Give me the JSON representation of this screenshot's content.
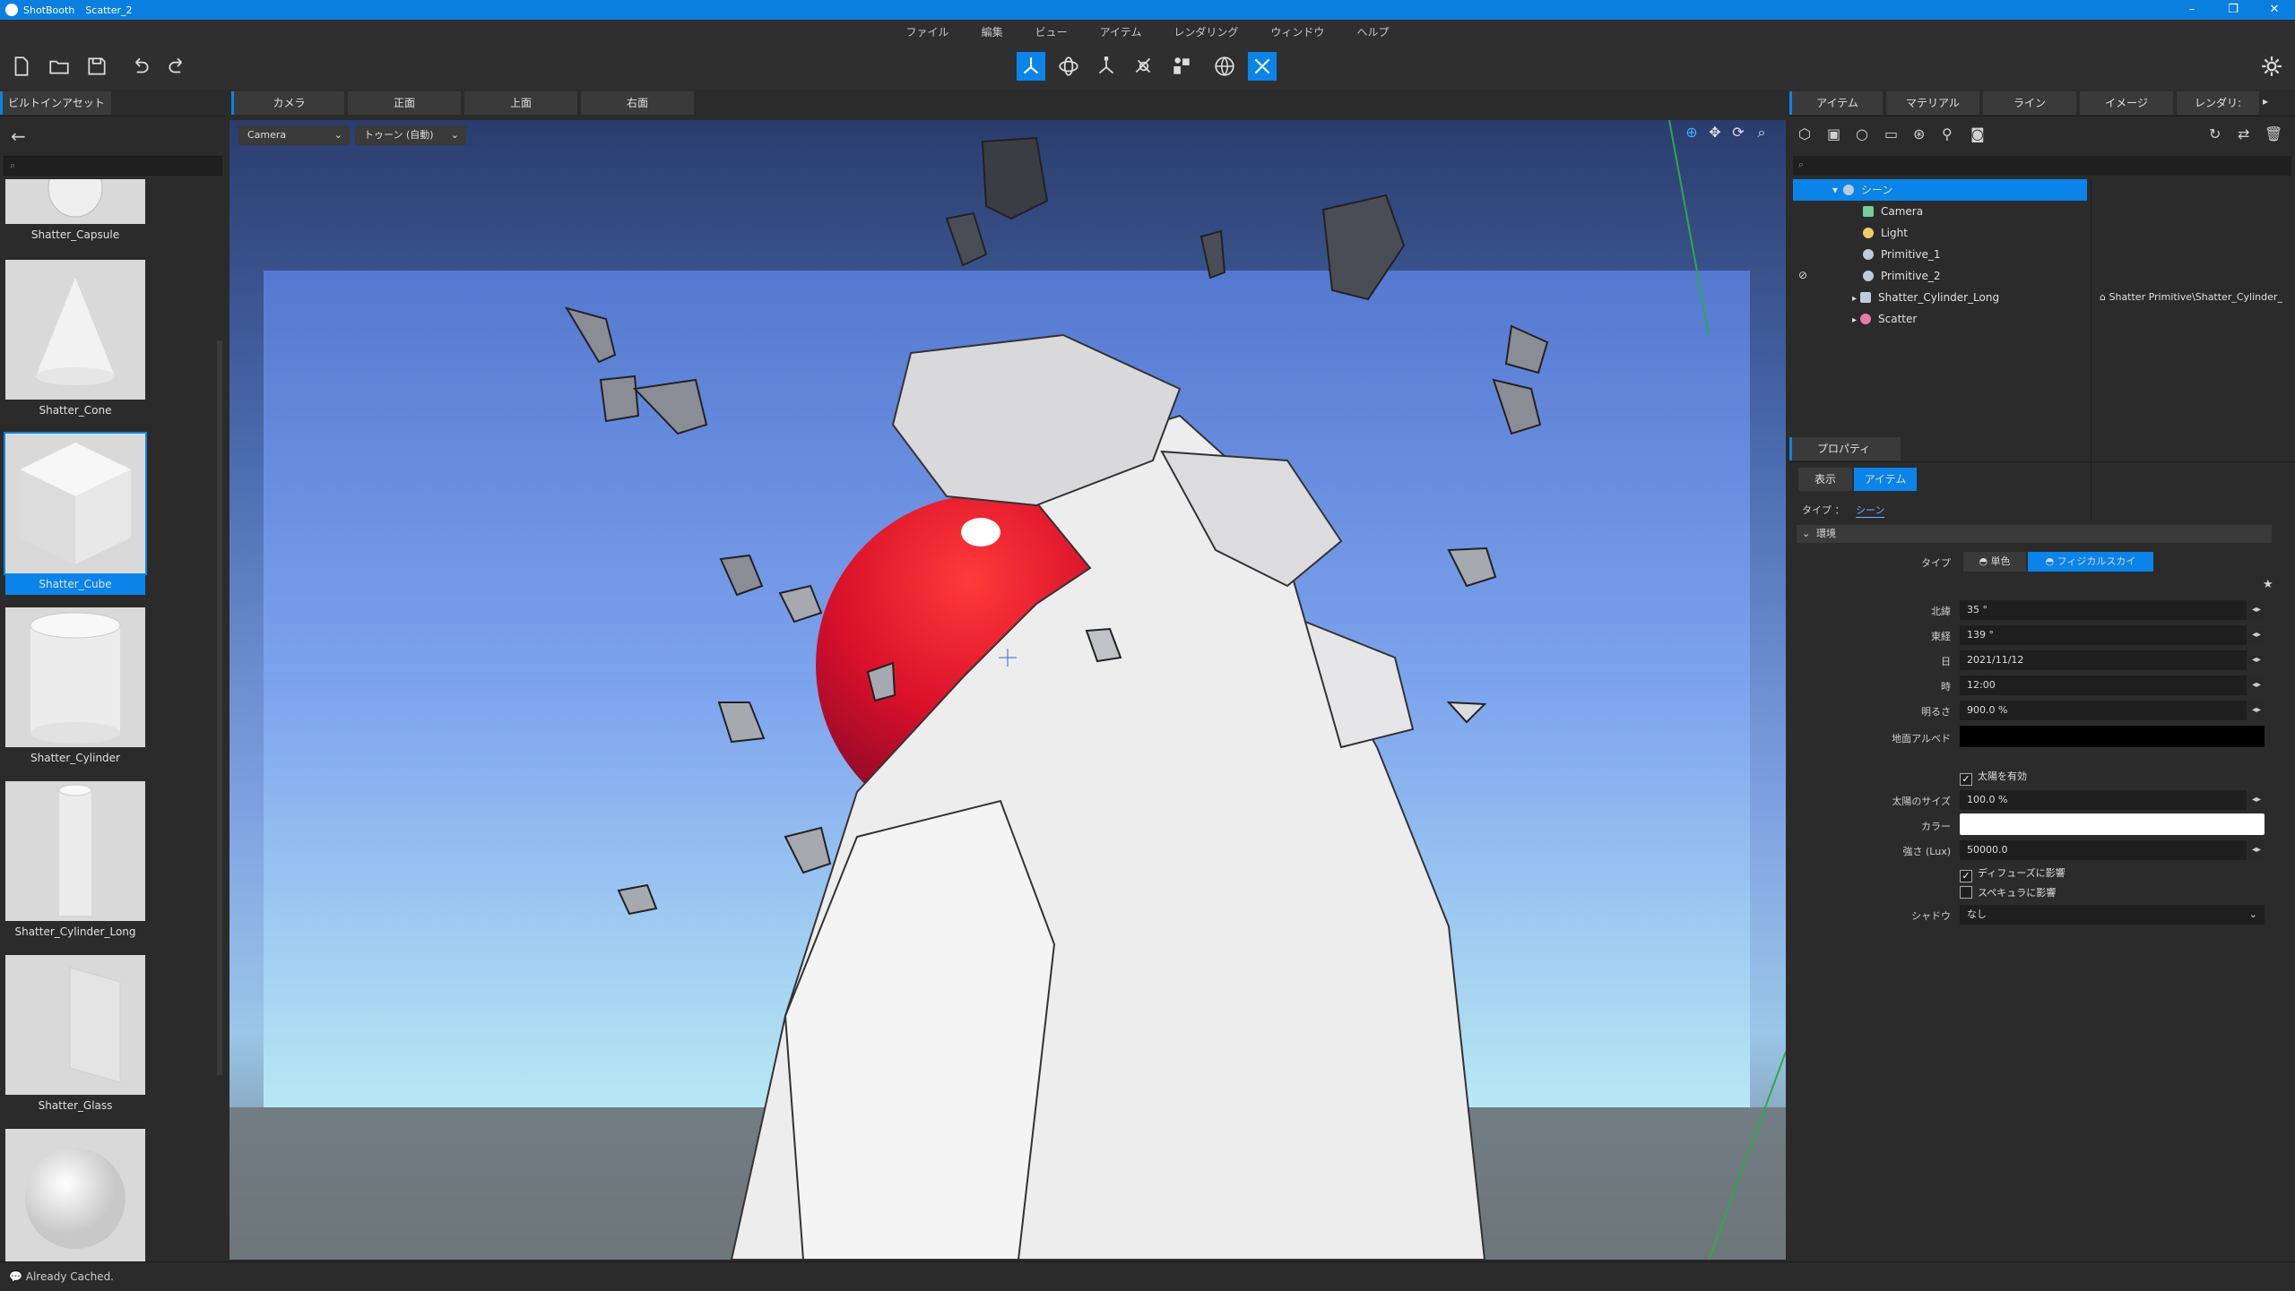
{
  "titlebar": {
    "app": "ShotBooth",
    "doc": "Scatter_2"
  },
  "menu": [
    "ファイル",
    "編集",
    "ビュー",
    "アイテム",
    "レンダリング",
    "ウィンドウ",
    "ヘルプ"
  ],
  "left_panel": {
    "tab": "ビルトインアセット",
    "assets": [
      "Shatter_Capsule",
      "Shatter_Cone",
      "Shatter_Cube",
      "Shatter_Cylinder",
      "Shatter_Cylinder_Long",
      "Shatter_Glass",
      ""
    ]
  },
  "viewport": {
    "tabs": [
      "カメラ",
      "正面",
      "上面",
      "右面"
    ],
    "camera_dropdown": "Camera",
    "shading_dropdown": "トゥーン (自動)"
  },
  "right_panel": {
    "tabs": [
      "アイテム",
      "マテリアル",
      "ライン",
      "イメージ",
      "レンダリ:"
    ],
    "tree": {
      "root": "シーン",
      "items": [
        "Camera",
        "Light",
        "Primitive_1",
        "Primitive_2",
        "Shatter_Cylinder_Long",
        "Scatter"
      ],
      "asset_path": "Shatter Primitive\\Shatter_Cylinder_"
    },
    "properties_tab": "プロパティ",
    "mode_tabs": [
      "表示",
      "アイテム"
    ],
    "type_label": "タイプ ：",
    "type_value": "シーン",
    "section": "環境",
    "env_type_label": "タイプ",
    "env_type_options": [
      "単色",
      "フィジカルスカイ"
    ],
    "fields": [
      {
        "label": "北緯",
        "value": "35 °"
      },
      {
        "label": "東経",
        "value": "139 °"
      },
      {
        "label": "日",
        "value": "2021/11/12"
      },
      {
        "label": "時",
        "value": "12:00"
      },
      {
        "label": "明るさ",
        "value": "900.0 %"
      }
    ],
    "ground_albedo_label": "地面アルベド",
    "sun_enable": "太陽を有効",
    "sun_size_label": "太陽のサイズ",
    "sun_size_value": "100.0 %",
    "color_label": "カラー",
    "intensity_label": "強さ (Lux)",
    "intensity_value": "50000.0",
    "affect_diffuse": "ディフューズに影響",
    "affect_specular": "スペキュラに影響",
    "shadow_label": "シャドウ",
    "shadow_value": "なし"
  },
  "status": "Already Cached.",
  "colors": {
    "accent": "#0a84e8",
    "titlebar": "#0a7fe0",
    "panel": "#2b2b2b"
  }
}
